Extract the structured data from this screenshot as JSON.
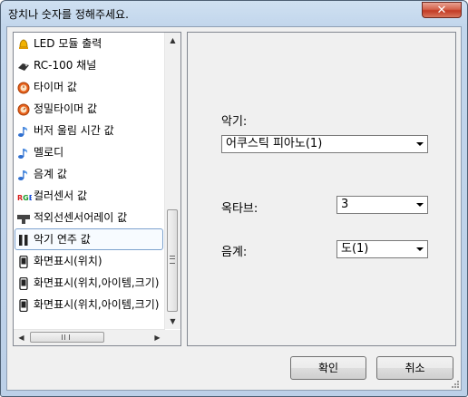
{
  "window": {
    "title": "장치나 숫자를 정해주세요.",
    "close_label": "✕"
  },
  "list": {
    "items": [
      {
        "label": "LED 모듈 출력",
        "icon": "bell-icon"
      },
      {
        "label": "RC-100 채널",
        "icon": "remote-control-icon"
      },
      {
        "label": "타이머 값",
        "icon": "timer-icon"
      },
      {
        "label": "정밀타이머 값",
        "icon": "precise-timer-icon"
      },
      {
        "label": "버저 울림 시간 값",
        "icon": "music-note-icon"
      },
      {
        "label": "멜로디",
        "icon": "music-note-icon"
      },
      {
        "label": "음계 값",
        "icon": "music-note-icon"
      },
      {
        "label": "컬러센서 값",
        "icon": "rgb-icon"
      },
      {
        "label": "적외선센서어레이 값",
        "icon": "ir-array-icon"
      },
      {
        "label": "악기 연주 값",
        "icon": "instrument-icon"
      },
      {
        "label": "화면표시(위치)",
        "icon": "phone-icon"
      },
      {
        "label": "화면표시(위치,아이템,크기)",
        "icon": "phone-icon"
      },
      {
        "label": "화면표시(위치,아이템,크기)",
        "icon": "phone-icon"
      }
    ],
    "selected_index": 9,
    "scroll": {
      "up": "▲",
      "down": "▼",
      "left": "◀",
      "right": "▶"
    }
  },
  "form": {
    "instrument_label": "악기:",
    "instrument_value": "어쿠스틱 피아노(1)",
    "octave_label": "옥타브:",
    "octave_value": "3",
    "scale_label": "음계:",
    "scale_value": "도(1)"
  },
  "buttons": {
    "ok": "확인",
    "cancel": "취소"
  },
  "colors": {
    "selection_border": "#7da2ce",
    "close_button": "#c23a24",
    "frame": "#bcd0e8"
  }
}
